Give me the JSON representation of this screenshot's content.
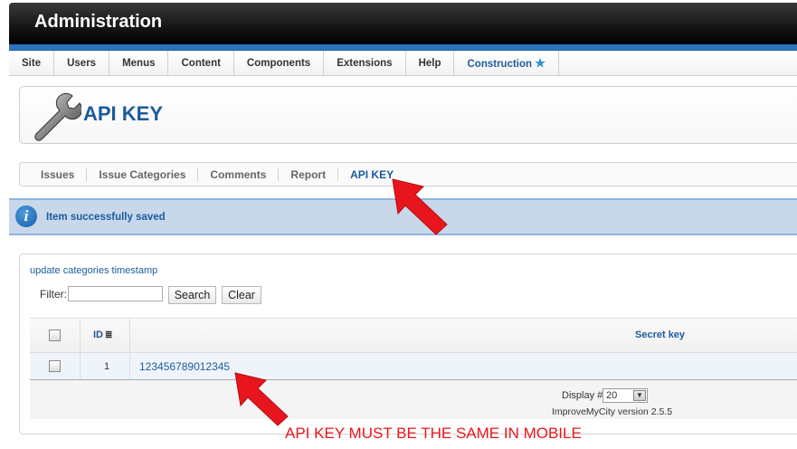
{
  "header": {
    "title": "Administration"
  },
  "menu": {
    "items": [
      "Site",
      "Users",
      "Menus",
      "Content",
      "Components",
      "Extensions",
      "Help"
    ],
    "construction_label": "Construction",
    "construction_icon": "star-icon"
  },
  "page": {
    "title": "API KEY",
    "icon": "wrench-icon"
  },
  "subnav": {
    "items": [
      "Issues",
      "Issue Categories",
      "Comments",
      "Report",
      "API KEY"
    ],
    "active": "API KEY"
  },
  "message": {
    "text": "Item successfully saved",
    "icon": "info-icon"
  },
  "content": {
    "update_link": "update categories timestamp",
    "filter_label": "Filter:",
    "filter_value": "",
    "search_button": "Search",
    "clear_button": "Clear",
    "table": {
      "headers": {
        "id": "ID",
        "secret": "Secret key"
      },
      "rows": [
        {
          "id": "1",
          "secret_key": "123456789012345"
        }
      ]
    },
    "display_label": "Display #",
    "display_value": "20",
    "version": "ImproveMyCity version 2.5.5"
  },
  "annotation": {
    "text": "API KEY MUST BE THE SAME IN MOBILE",
    "color": "#e8161c"
  },
  "colors": {
    "accent": "#1c5a9c",
    "header_bar": "#2a74c0",
    "message_bg": "#c8d8ea"
  }
}
